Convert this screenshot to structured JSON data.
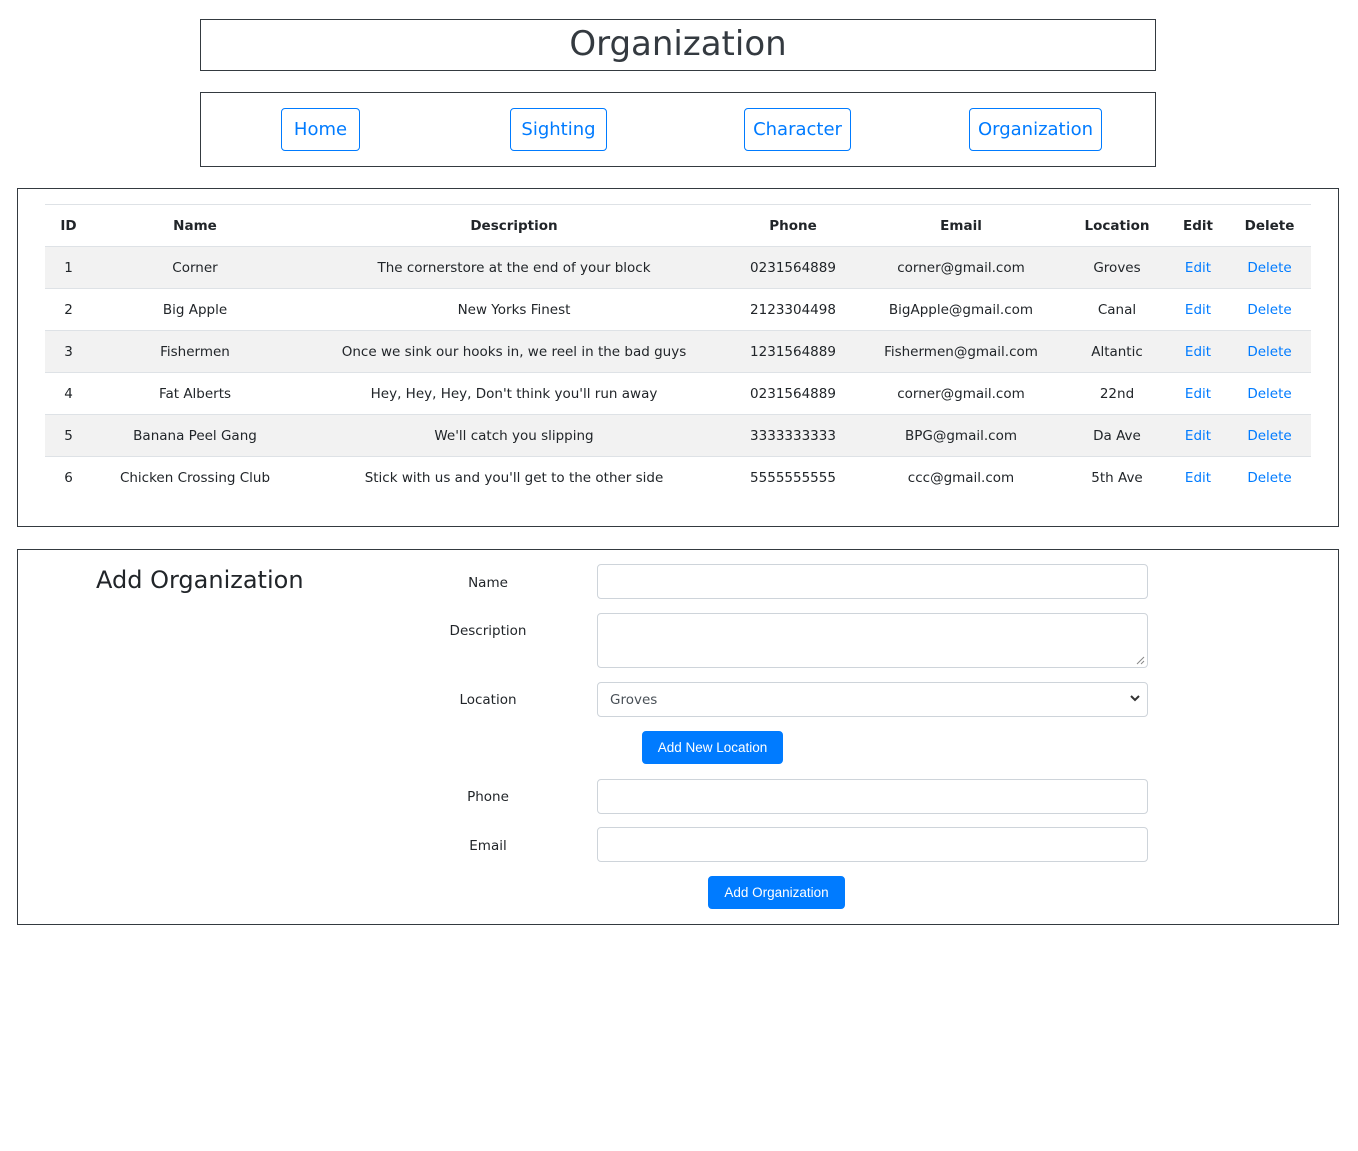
{
  "header": {
    "title": "Organization"
  },
  "nav": {
    "items": [
      {
        "label": "Home"
      },
      {
        "label": "Sighting"
      },
      {
        "label": "Character"
      },
      {
        "label": "Organization"
      }
    ]
  },
  "table": {
    "columns": [
      "ID",
      "Name",
      "Description",
      "Phone",
      "Email",
      "Location",
      "Edit",
      "Delete"
    ],
    "rows": [
      {
        "id": "1",
        "name": "Corner",
        "description": "The cornerstore at the end of your block",
        "phone": "0231564889",
        "email": "corner@gmail.com",
        "location": "Groves",
        "edit": "Edit",
        "delete": "Delete"
      },
      {
        "id": "2",
        "name": "Big Apple",
        "description": "New Yorks Finest",
        "phone": "2123304498",
        "email": "BigApple@gmail.com",
        "location": "Canal",
        "edit": "Edit",
        "delete": "Delete"
      },
      {
        "id": "3",
        "name": "Fishermen",
        "description": "Once we sink our hooks in, we reel in the bad guys",
        "phone": "1231564889",
        "email": "Fishermen@gmail.com",
        "location": "Altantic",
        "edit": "Edit",
        "delete": "Delete"
      },
      {
        "id": "4",
        "name": "Fat Alberts",
        "description": "Hey, Hey, Hey, Don't think you'll run away",
        "phone": "0231564889",
        "email": "corner@gmail.com",
        "location": "22nd",
        "edit": "Edit",
        "delete": "Delete"
      },
      {
        "id": "5",
        "name": "Banana Peel Gang",
        "description": "We'll catch you slipping",
        "phone": "3333333333",
        "email": "BPG@gmail.com",
        "location": "Da Ave",
        "edit": "Edit",
        "delete": "Delete"
      },
      {
        "id": "6",
        "name": "Chicken Crossing Club",
        "description": "Stick with us and you'll get to the other side",
        "phone": "5555555555",
        "email": "ccc@gmail.com",
        "location": "5th Ave",
        "edit": "Edit",
        "delete": "Delete"
      }
    ]
  },
  "form": {
    "title": "Add Organization",
    "name_label": "Name",
    "name_value": "",
    "description_label": "Description",
    "description_value": "",
    "location_label": "Location",
    "location_selected": "Groves",
    "add_location_label": "Add New Location",
    "phone_label": "Phone",
    "phone_value": "",
    "email_label": "Email",
    "email_value": "",
    "submit_label": "Add Organization"
  },
  "icons": {
    "select_arrow": "chevron-down-icon",
    "textarea_grip": "resize-grip-icon"
  },
  "colors": {
    "primary": "#007bff",
    "border": "#343a40",
    "stripe": "#f2f2f2"
  }
}
